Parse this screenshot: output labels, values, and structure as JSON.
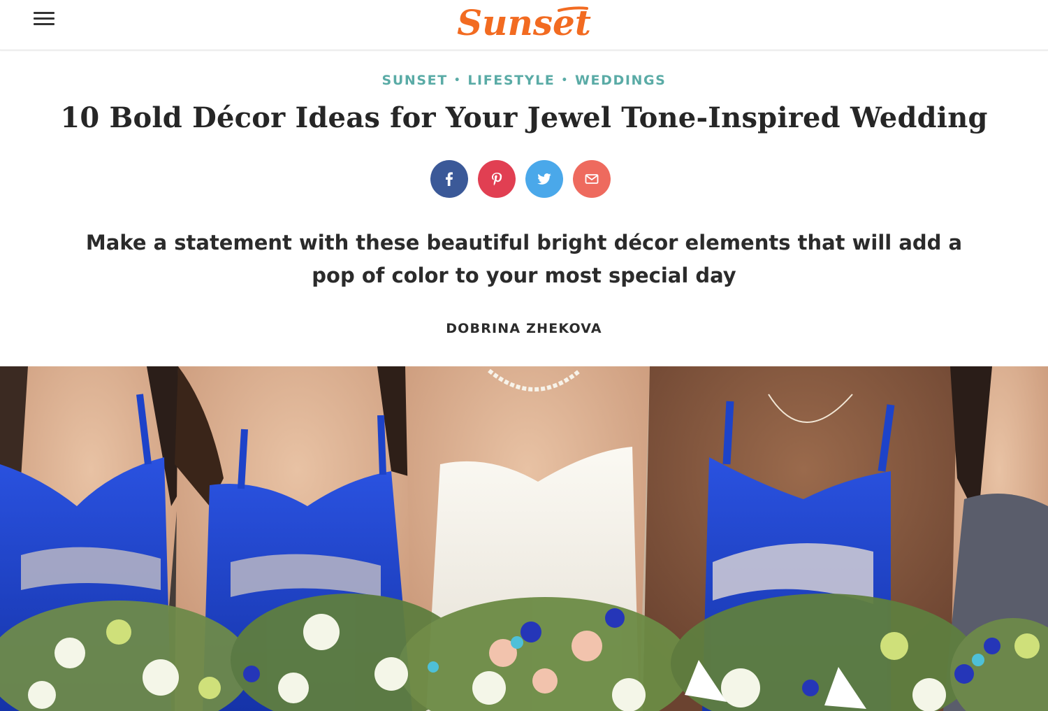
{
  "header": {
    "menu_icon": "hamburger-menu-icon",
    "logo_text": "Sunset",
    "logo_color": "#f26b21"
  },
  "breadcrumb": {
    "items": [
      "SUNSET",
      "LIFESTYLE",
      "WEDDINGS"
    ],
    "separator": "•",
    "color": "#5aaba6"
  },
  "article": {
    "title": "10 Bold Décor Ideas for Your Jewel Tone-Inspired Wedding",
    "dek": "Make a statement with these beautiful bright décor elements that will add a pop of color to your most special day",
    "author": "DOBRINA ZHEKOVA"
  },
  "share": {
    "buttons": [
      {
        "name": "facebook",
        "icon": "facebook-icon",
        "color": "#3b5998"
      },
      {
        "name": "pinterest",
        "icon": "pinterest-icon",
        "color": "#e13f52"
      },
      {
        "name": "twitter",
        "icon": "twitter-icon",
        "color": "#4aa8ea"
      },
      {
        "name": "email",
        "icon": "email-icon",
        "color": "#ee6a5e"
      }
    ]
  },
  "hero": {
    "dress_color": "#1d43c9",
    "gown_color": "#f4f1ea"
  }
}
